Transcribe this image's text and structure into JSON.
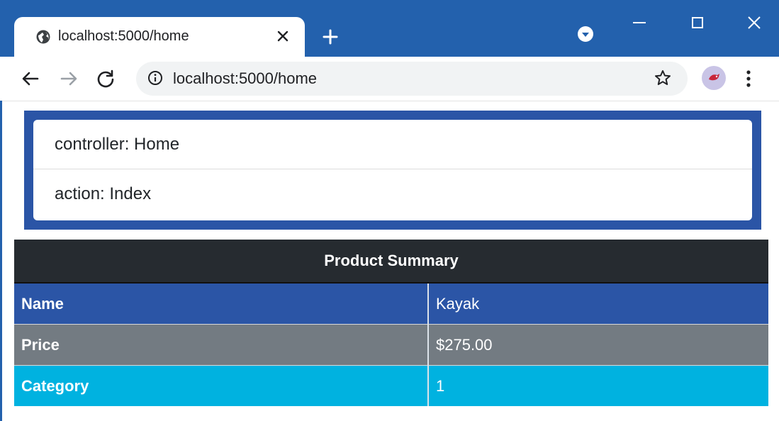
{
  "browser": {
    "tab_title": "localhost:5000/home",
    "url": "localhost:5000/home",
    "icons": {
      "tab": "globe-icon",
      "close": "close-icon",
      "new_tab": "plus-icon",
      "profile": "chevron-down-circle-icon",
      "back": "back-arrow-icon",
      "forward": "forward-arrow-icon",
      "reload": "reload-icon",
      "info": "info-icon",
      "bookmark": "star-icon",
      "avatar": "avatar-bird-icon",
      "menu": "more-vert-icon"
    },
    "colors": {
      "frame": "#2361ad",
      "omnibox": "#f1f3f4"
    }
  },
  "route_info": {
    "items": [
      {
        "text": "controller: Home"
      },
      {
        "text": "action: Index"
      }
    ],
    "colors": {
      "border": "#2b55a6"
    }
  },
  "summary": {
    "header": "Product Summary",
    "rows": [
      {
        "key": "Name",
        "value": "Kayak",
        "color": "#2b55a6"
      },
      {
        "key": "Price",
        "value": "$275.00",
        "color": "#737b82"
      },
      {
        "key": "Category",
        "value": "1",
        "color": "#00b2e0"
      }
    ],
    "colors": {
      "header_bg": "#262b30"
    }
  }
}
